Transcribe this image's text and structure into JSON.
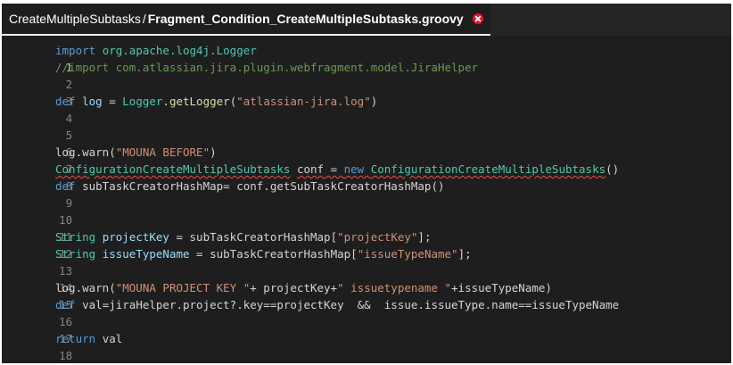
{
  "tab": {
    "folder": "CreateMultipleSubtasks",
    "separator": "/",
    "file": "Fragment_Condition_CreateMultipleSubtasks.groovy",
    "close_icon": "close-icon"
  },
  "editor": {
    "active_line": 1,
    "line_numbers": [
      "1",
      "2",
      "3",
      "4",
      "5",
      "6",
      "7",
      "8",
      "9",
      "10",
      "11",
      "12",
      "13",
      "14",
      "15",
      "16",
      "17",
      "18"
    ],
    "lines": {
      "l1": [
        "import ",
        "org.apache.log4j.Logger"
      ],
      "l2": [
        "//import com.atlassian.jira.plugin.webfragment.model.JiraHelper"
      ],
      "l4": [
        "def ",
        "log",
        " = ",
        "Logger",
        ".",
        "getLogger",
        "(",
        "\"atlassian-jira.log\"",
        ")"
      ],
      "l7": [
        "log.warn(",
        "\"MOUNA BEFORE\"",
        ")"
      ],
      "l8": [
        "ConfigurationCreateMultipleSubtasks",
        " ",
        "conf",
        " = ",
        "new ",
        "ConfigurationCreateMultipleSubtasks",
        "()"
      ],
      "l9": [
        "def ",
        "subTaskCreatorHashMap= conf.getSubTaskCreatorHashMap()"
      ],
      "l12": [
        "String ",
        "projectKey",
        " = subTaskCreatorHashMap[",
        "\"projectKey\"",
        "];"
      ],
      "l13": [
        "String ",
        "issueTypeName",
        " = subTaskCreatorHashMap[",
        "\"issueTypeName\"",
        "];"
      ],
      "l15": [
        "log.warn(",
        "\"MOUNA PROJECT KEY \"",
        "+ projectKey+",
        "\" issuetypename \"",
        "+issueTypeName)"
      ],
      "l16": [
        "def ",
        "val=jiraHelper.project?.key==projectKey  &&  issue.issueType.name==issueTypeName"
      ],
      "l18": [
        "return ",
        "val"
      ]
    }
  }
}
